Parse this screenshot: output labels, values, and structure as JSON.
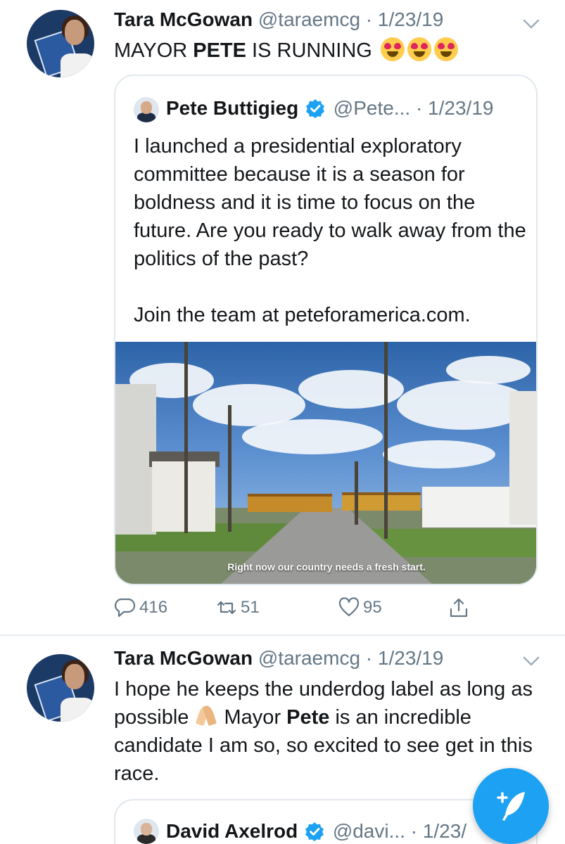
{
  "tweets": [
    {
      "author_name": "Tara McGowan",
      "handle_date": "@taraemcg · 1/23/19",
      "text_before": "MAYOR ",
      "text_bold": "PETE",
      "text_after": " IS RUNNING",
      "emoji": "smiling-face-with-heart-eyes",
      "quoted": {
        "author_name": "Pete Buttigieg",
        "handle_date": "@Pete... · 1/23/19",
        "text_p1": "I launched a presidential exploratory committee because it is a season for boldness and it is time to focus on the future. Are you ready to walk away from the politics of the past?",
        "text_p2": "Join the team at peteforamerica.com.",
        "video_caption": "Right now our country needs a fresh start."
      },
      "actions": {
        "replies": "416",
        "retweets": "51",
        "likes": "95"
      }
    },
    {
      "author_name": "Tara McGowan",
      "handle_date": "@taraemcg · 1/23/19",
      "text_a": "I hope he keeps the underdog label as long as possible ",
      "text_b": " Mayor ",
      "text_bold": "Pete",
      "text_c": " is an incredible candidate I am so, so excited to see get in this race.",
      "emoji": "folded-hands",
      "quoted": {
        "author_name": "David Axelrod",
        "handle_date": "@davi...  · 1/23/"
      }
    }
  ],
  "colors": {
    "accent": "#1da1f2",
    "secondary_text": "#657786",
    "border": "#e1e8ed"
  },
  "compose_button": "compose-tweet"
}
